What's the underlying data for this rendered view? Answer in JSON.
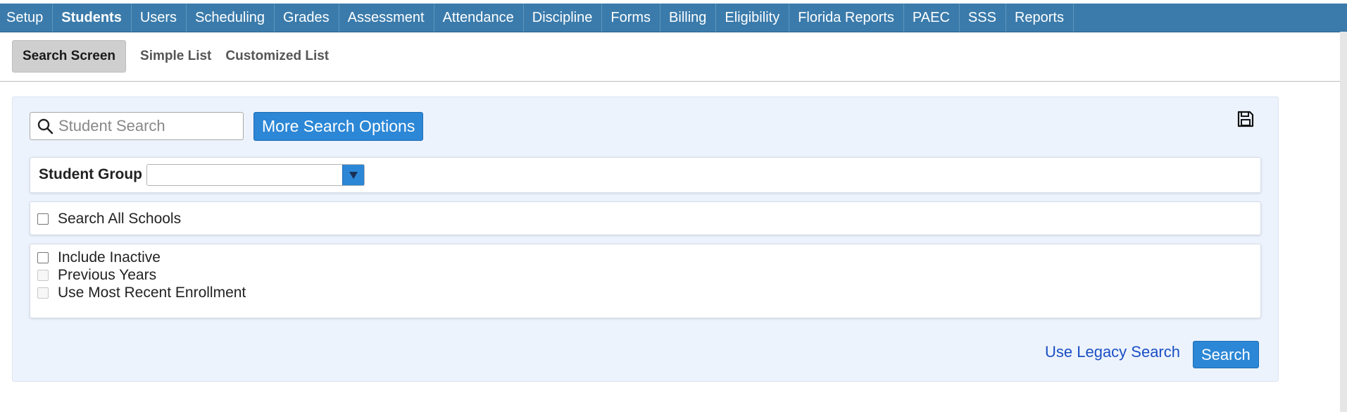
{
  "topnav": {
    "items": [
      {
        "label": "Setup"
      },
      {
        "label": "Students",
        "active": true
      },
      {
        "label": "Users"
      },
      {
        "label": "Scheduling"
      },
      {
        "label": "Grades"
      },
      {
        "label": "Assessment"
      },
      {
        "label": "Attendance"
      },
      {
        "label": "Discipline"
      },
      {
        "label": "Forms"
      },
      {
        "label": "Billing"
      },
      {
        "label": "Eligibility"
      },
      {
        "label": "Florida Reports"
      },
      {
        "label": "PAEC"
      },
      {
        "label": "SSS"
      },
      {
        "label": "Reports"
      }
    ]
  },
  "subnav": {
    "items": [
      {
        "label": "Search Screen",
        "active": true
      },
      {
        "label": "Simple List"
      },
      {
        "label": "Customized List"
      }
    ]
  },
  "search": {
    "placeholder": "Student Search",
    "value": "",
    "more_options_label": "More Search Options",
    "search_icon": "search-icon",
    "save_icon": "save-icon"
  },
  "student_group": {
    "label": "Student Group",
    "selected": ""
  },
  "search_all_schools": {
    "label": "Search All Schools",
    "checked": false
  },
  "options": {
    "include_inactive": {
      "label": "Include Inactive",
      "checked": false,
      "enabled": true
    },
    "previous_years": {
      "label": "Previous Years",
      "checked": false,
      "enabled": false
    },
    "use_most_recent_enrollment": {
      "label": "Use Most Recent Enrollment",
      "checked": false,
      "enabled": false
    }
  },
  "footer": {
    "legacy_link": "Use Legacy Search",
    "search_button": "Search"
  },
  "colors": {
    "topbar": "#3a7bab",
    "button": "#2c87d6",
    "panel_bg": "#edf3fd",
    "link": "#1a4fc4"
  }
}
